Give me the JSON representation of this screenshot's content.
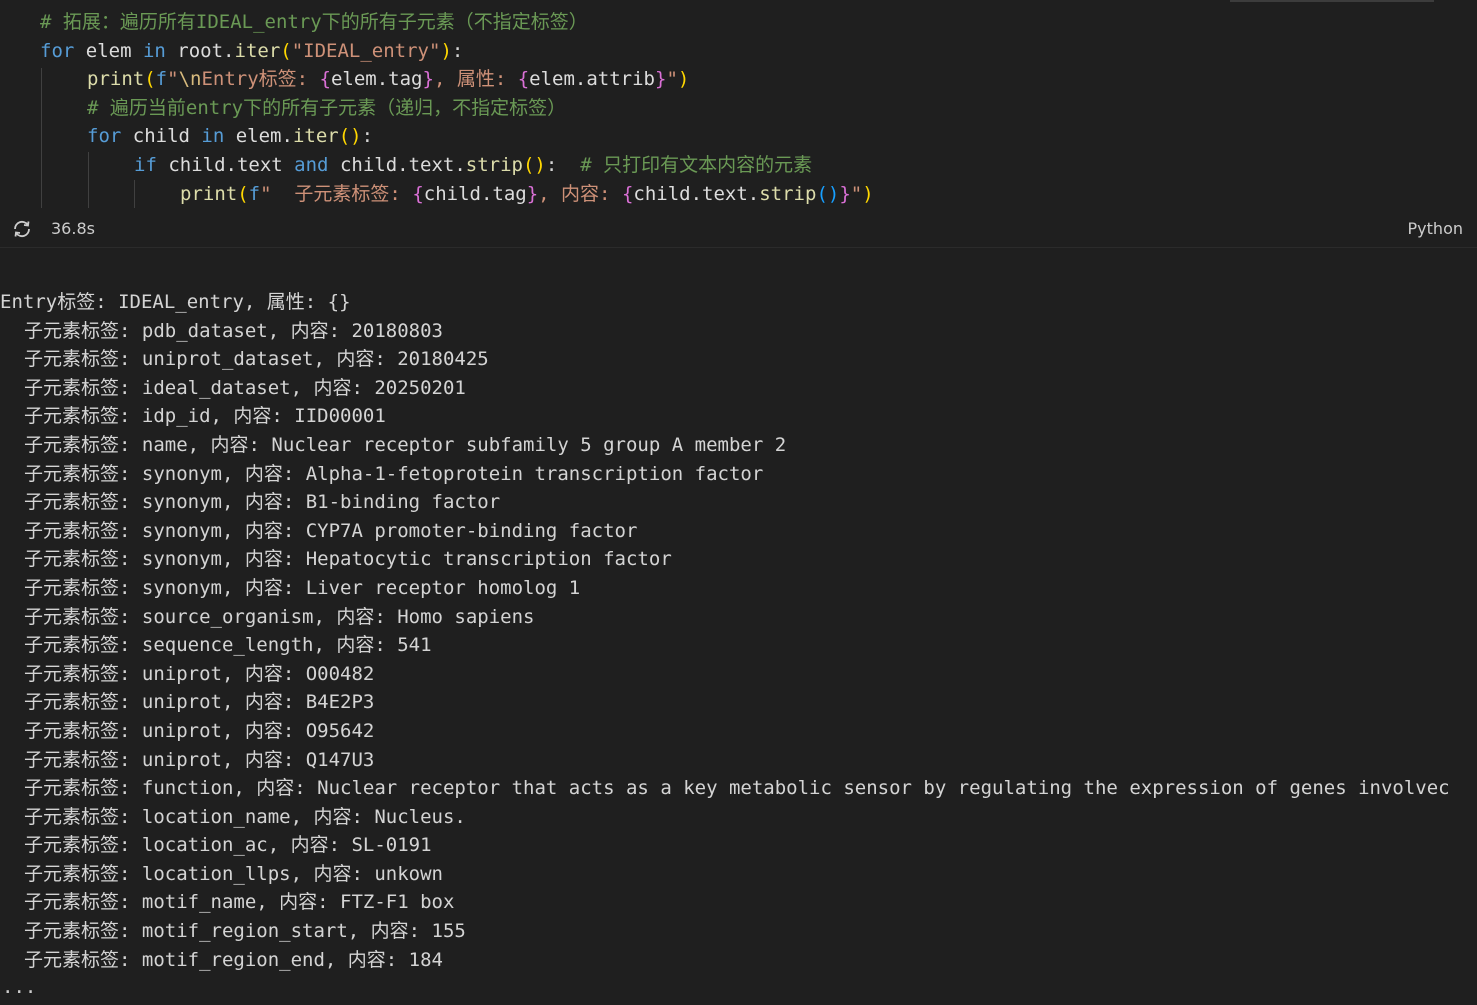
{
  "cell": {
    "lines": [
      {
        "indent": 40,
        "tokens": [
          {
            "c": "cm",
            "t": "# 拓展：遍历所有IDEAL_entry下的所有子元素（不指定标签）"
          }
        ]
      },
      {
        "indent": 40,
        "tokens": [
          {
            "c": "kw",
            "t": "for"
          },
          {
            "c": "id",
            "t": " elem "
          },
          {
            "c": "kw",
            "t": "in"
          },
          {
            "c": "id",
            "t": " root."
          },
          {
            "c": "fn",
            "t": "iter"
          },
          {
            "c": "b1",
            "t": "("
          },
          {
            "c": "str",
            "t": "\"IDEAL_entry\""
          },
          {
            "c": "b1",
            "t": ")"
          },
          {
            "c": "p",
            "t": ":"
          }
        ]
      },
      {
        "indent": 87,
        "tokens": [
          {
            "c": "fn",
            "t": "print"
          },
          {
            "c": "b1",
            "t": "("
          },
          {
            "c": "kw",
            "t": "f"
          },
          {
            "c": "str",
            "t": "\""
          },
          {
            "c": "esc",
            "t": "\\n"
          },
          {
            "c": "str",
            "t": "Entry标签: "
          },
          {
            "c": "b2",
            "t": "{"
          },
          {
            "c": "id",
            "t": "elem.tag"
          },
          {
            "c": "b2",
            "t": "}"
          },
          {
            "c": "str",
            "t": ", 属性: "
          },
          {
            "c": "b2",
            "t": "{"
          },
          {
            "c": "id",
            "t": "elem.attrib"
          },
          {
            "c": "b2",
            "t": "}"
          },
          {
            "c": "str",
            "t": "\""
          },
          {
            "c": "b1",
            "t": ")"
          }
        ]
      },
      {
        "indent": 87,
        "tokens": [
          {
            "c": "cm",
            "t": "# 遍历当前entry下的所有子元素（递归，不指定标签）"
          }
        ]
      },
      {
        "indent": 87,
        "tokens": [
          {
            "c": "kw",
            "t": "for"
          },
          {
            "c": "id",
            "t": " child "
          },
          {
            "c": "kw",
            "t": "in"
          },
          {
            "c": "id",
            "t": " elem."
          },
          {
            "c": "fn",
            "t": "iter"
          },
          {
            "c": "b1",
            "t": "()"
          },
          {
            "c": "p",
            "t": ":"
          }
        ]
      },
      {
        "indent": 134,
        "tokens": [
          {
            "c": "kw",
            "t": "if"
          },
          {
            "c": "id",
            "t": " child.text "
          },
          {
            "c": "kw",
            "t": "and"
          },
          {
            "c": "id",
            "t": " child.text."
          },
          {
            "c": "fn",
            "t": "strip"
          },
          {
            "c": "b1",
            "t": "()"
          },
          {
            "c": "p",
            "t": ":  "
          },
          {
            "c": "cm",
            "t": "# 只打印有文本内容的元素"
          }
        ]
      },
      {
        "indent": 180,
        "tokens": [
          {
            "c": "fn",
            "t": "print"
          },
          {
            "c": "b1",
            "t": "("
          },
          {
            "c": "kw",
            "t": "f"
          },
          {
            "c": "str",
            "t": "\"  子元素标签: "
          },
          {
            "c": "b2",
            "t": "{"
          },
          {
            "c": "id",
            "t": "child.tag"
          },
          {
            "c": "b2",
            "t": "}"
          },
          {
            "c": "str",
            "t": ", 内容: "
          },
          {
            "c": "b2",
            "t": "{"
          },
          {
            "c": "id",
            "t": "child.text."
          },
          {
            "c": "fn",
            "t": "strip"
          },
          {
            "c": "b3",
            "t": "()"
          },
          {
            "c": "b2",
            "t": "}"
          },
          {
            "c": "str",
            "t": "\""
          },
          {
            "c": "b1",
            "t": ")"
          }
        ]
      }
    ]
  },
  "status": {
    "duration": "36.8s",
    "language": "Python",
    "refresh_icon": "refresh-icon"
  },
  "output": {
    "header": "Entry标签: IDEAL_entry, 属性: {}",
    "lines": [
      "子元素标签: pdb_dataset, 内容: 20180803",
      "子元素标签: uniprot_dataset, 内容: 20180425",
      "子元素标签: ideal_dataset, 内容: 20250201",
      "子元素标签: idp_id, 内容: IID00001",
      "子元素标签: name, 内容: Nuclear receptor subfamily 5 group A member 2",
      "子元素标签: synonym, 内容: Alpha-1-fetoprotein transcription factor",
      "子元素标签: synonym, 内容: B1-binding factor",
      "子元素标签: synonym, 内容: CYP7A promoter-binding factor",
      "子元素标签: synonym, 内容: Hepatocytic transcription factor",
      "子元素标签: synonym, 内容: Liver receptor homolog 1",
      "子元素标签: source_organism, 内容: Homo sapiens",
      "子元素标签: sequence_length, 内容: 541",
      "子元素标签: uniprot, 内容: O00482",
      "子元素标签: uniprot, 内容: B4E2P3",
      "子元素标签: uniprot, 内容: O95642",
      "子元素标签: uniprot, 内容: Q147U3",
      "子元素标签: function, 内容: Nuclear receptor that acts as a key metabolic sensor by regulating the expression of genes involvec",
      "子元素标签: location_name, 内容: Nucleus.",
      "子元素标签: location_ac, 内容: SL-0191",
      "子元素标签: location_llps, 内容: unkown",
      "子元素标签: motif_name, 内容: FTZ-F1 box",
      "子元素标签: motif_region_start, 内容: 155",
      "子元素标签: motif_region_end, 内容: 184"
    ],
    "ellipsis": "..."
  }
}
